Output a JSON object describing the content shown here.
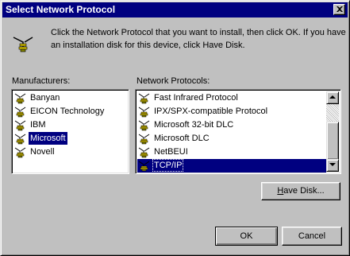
{
  "window": {
    "title": "Select Network Protocol"
  },
  "intro_text": "Click the Network Protocol that you want to install, then click OK. If you have an installation disk for this device, click Have Disk.",
  "manufacturers": {
    "label": "Manufacturers:",
    "items": [
      "Banyan",
      "EICON Technology",
      "IBM",
      "Microsoft",
      "Novell"
    ],
    "selected": "Microsoft"
  },
  "protocols": {
    "label": "Network Protocols:",
    "items": [
      "Fast Infrared Protocol",
      "IPX/SPX-compatible Protocol",
      "Microsoft 32-bit DLC",
      "Microsoft DLC",
      "NetBEUI",
      "TCP/IP"
    ],
    "selected": "TCP/IP"
  },
  "buttons": {
    "have_disk_first": "H",
    "have_disk_rest": "ave Disk...",
    "ok": "OK",
    "cancel": "Cancel"
  },
  "icons": {
    "protocol": "network-protocol-icon",
    "close": "close-icon"
  },
  "colors": {
    "face": "#c0c0c0",
    "title_bar": "#000080",
    "selection": "#000080"
  }
}
